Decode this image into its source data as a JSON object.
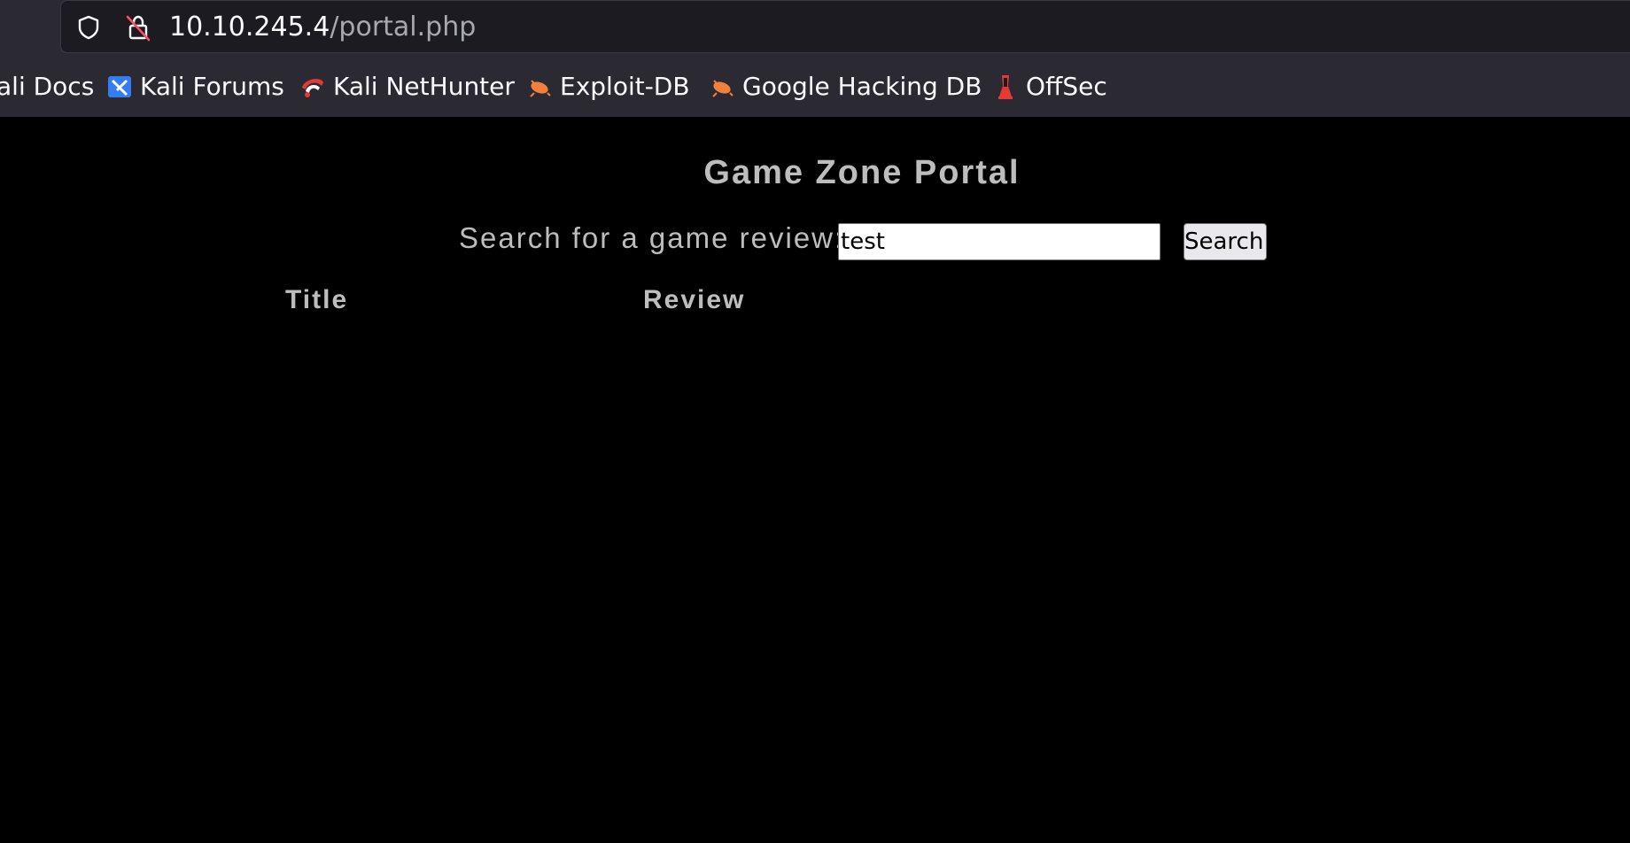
{
  "browser": {
    "url_host": "10.10.245.4",
    "url_path": "/portal.php",
    "bookmarks": [
      {
        "label": "ali Docs",
        "icon": "kali-docs-icon"
      },
      {
        "label": "Kali Forums",
        "icon": "kali-forums-icon"
      },
      {
        "label": "Kali NetHunter",
        "icon": "kali-nethunter-icon"
      },
      {
        "label": "Exploit-DB",
        "icon": "exploit-db-icon"
      },
      {
        "label": "Google Hacking DB",
        "icon": "google-hacking-db-icon"
      },
      {
        "label": "OffSec",
        "icon": "offsec-icon"
      }
    ]
  },
  "page": {
    "title": "Game Zone Portal",
    "search_label": "Search for a game review:",
    "search_value": "test",
    "search_button": "Search!",
    "columns": [
      "Title",
      "Review"
    ]
  },
  "colors": {
    "page_background": "#000000",
    "text": "#bdbdbd",
    "chrome_background": "#2b2a33"
  }
}
